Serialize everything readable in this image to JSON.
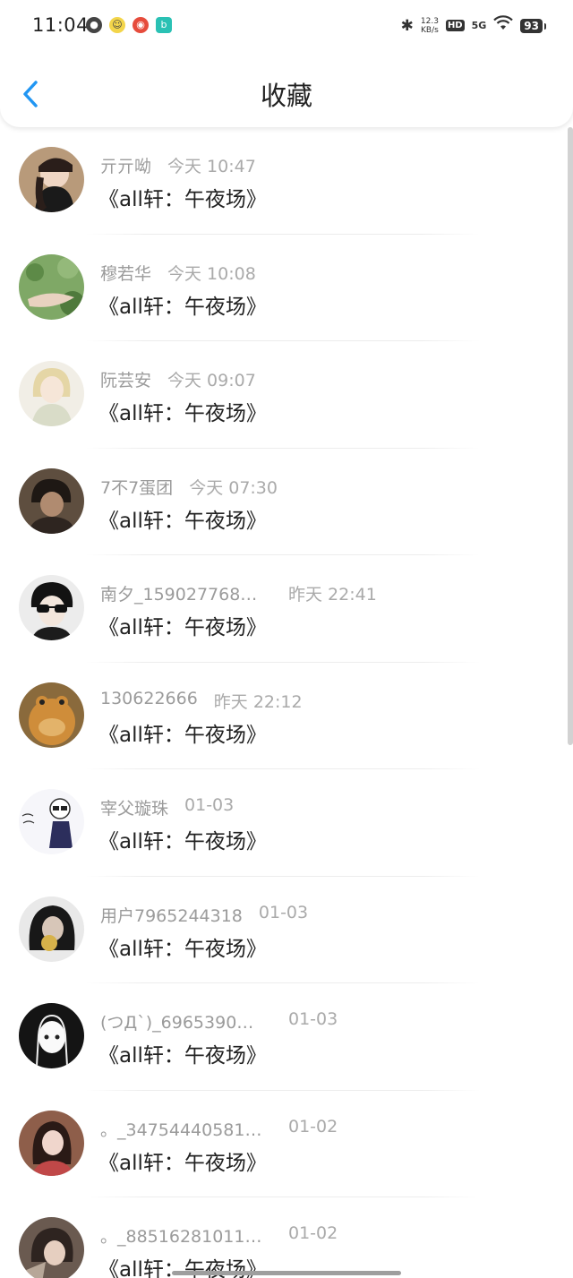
{
  "status_bar": {
    "time": "11:04",
    "net_speed_value": "12.3",
    "net_speed_unit": "KB/s",
    "hd": "HD",
    "signal": "5G",
    "battery": "93"
  },
  "header": {
    "title": "收藏"
  },
  "items": [
    {
      "username": "亓亓呦",
      "time": "今天 10:47",
      "title": "《all轩：午夜场》",
      "avatar_color": "#5a4a3e"
    },
    {
      "username": "穆若华",
      "time": "今天 10:08",
      "title": "《all轩：午夜场》",
      "avatar_color": "#6e9a5a"
    },
    {
      "username": "阮芸安",
      "time": "今天 09:07",
      "title": "《all轩：午夜场》",
      "avatar_color": "#e6dcc2"
    },
    {
      "username": "7不7蛋团",
      "time": "今天 07:30",
      "title": "《all轩：午夜场》",
      "avatar_color": "#4a3c30"
    },
    {
      "username": "南夕_159027768…",
      "time": "昨天 22:41",
      "title": "《all轩：午夜场》",
      "avatar_color": "#2a2a2a"
    },
    {
      "username": "130622666",
      "time": "昨天 22:12",
      "title": "《all轩：午夜场》",
      "avatar_color": "#c98a3e"
    },
    {
      "username": "宰父璇珠",
      "time": "01-03",
      "title": "《all轩：午夜场》",
      "avatar_color": "#f2f2f6"
    },
    {
      "username": "用户7965244318",
      "time": "01-03",
      "title": "《all轩：午夜场》",
      "avatar_color": "#3a3a3a"
    },
    {
      "username": "(つД`)_69653902…",
      "time": "01-03",
      "title": "《all轩：午夜场》",
      "avatar_color": "#1e1e1e"
    },
    {
      "username": "。_34754440581…",
      "time": "01-02",
      "title": "《all轩：午夜场》",
      "avatar_color": "#7a4a3e"
    },
    {
      "username": "。_88516281011…",
      "time": "01-02",
      "title": "《all轩：午夜场》",
      "avatar_color": "#5c4e46"
    }
  ],
  "colors": {
    "accent": "#2196f3",
    "meta_text": "#9b9b9b",
    "title_text": "#222222"
  }
}
